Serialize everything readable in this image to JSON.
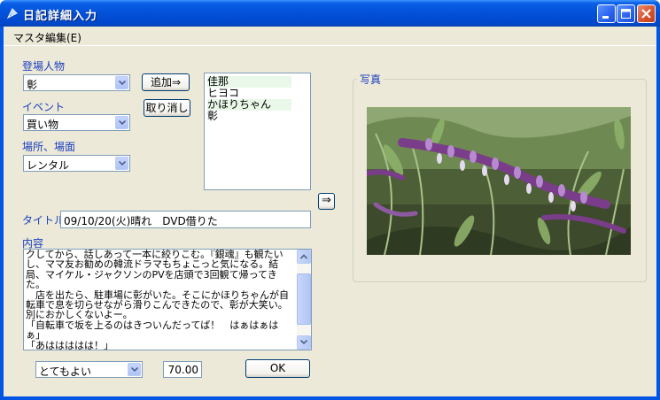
{
  "window": {
    "title": "日記詳細入力"
  },
  "menu": {
    "items": [
      "マスタ編集(E)"
    ]
  },
  "characters": {
    "label": "登場人物",
    "combo_value": "彰",
    "add_button": "追加⇒",
    "remove_button": "取り消し",
    "list": [
      "佳那",
      "ヒヨコ",
      "かほりちゃん",
      "彰"
    ]
  },
  "event": {
    "label": "イベント",
    "combo_value": "買い物"
  },
  "place": {
    "label": "場所、場面",
    "combo_value": "レンタル"
  },
  "arrow_button": "⇒",
  "title_field": {
    "label": "タイトル",
    "value": "09/10/20(火)晴れ　DVD借りた"
  },
  "content": {
    "label": "内容",
    "text": "クしてから、話しあって一本に絞りこむ。『銀魂』も観たいし、ママ友お勧めの韓流ドラマもちょこっと気になる。結局、マイケル・ジャクソンのPVを店頭で3回観て帰ってきた。\n　店を出たら、駐車場に彰がいた。そこにかほりちゃんが自転車で息を切らせながら滑りこんできたので、彰が大笑い。別におかしくないよー。\n「自転車で坂を上るのはきついんだってば！　はぁはぁはぁ」\n「あははははは！」\n「ひっどー」"
  },
  "rating": {
    "combo_value": "とてもよい",
    "score": "70.00"
  },
  "ok_button": "OK",
  "photo": {
    "label": "写真"
  },
  "colors": {
    "title_bar": "#0350d8",
    "client_bg": "#ece9d8",
    "label_text": "#1a3fbf",
    "list_highlight": "#e9f8e9"
  }
}
